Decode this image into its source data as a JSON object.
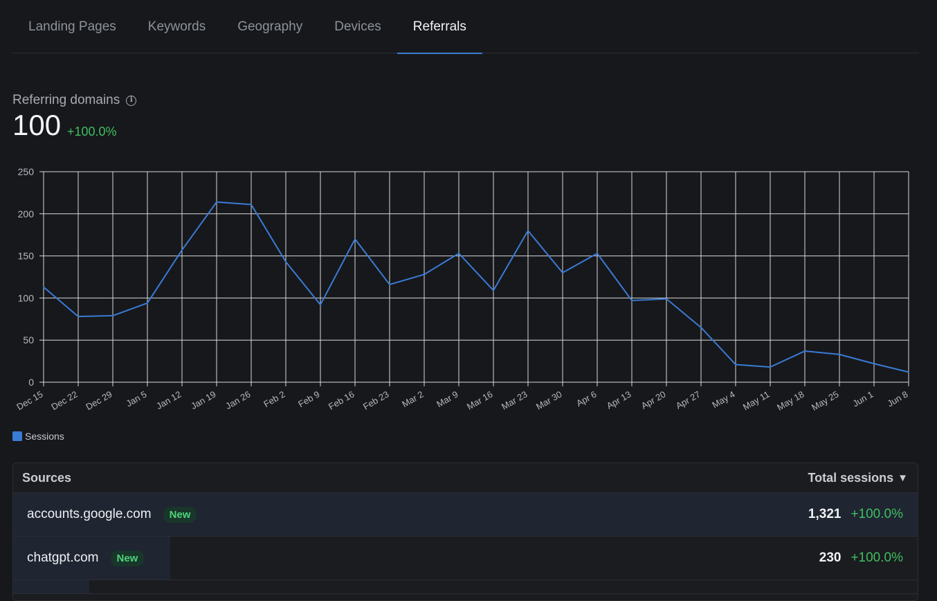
{
  "tabs": [
    {
      "label": "Landing Pages",
      "active": false
    },
    {
      "label": "Keywords",
      "active": false
    },
    {
      "label": "Geography",
      "active": false
    },
    {
      "label": "Devices",
      "active": false
    },
    {
      "label": "Referrals",
      "active": true
    }
  ],
  "metric": {
    "label": "Referring domains",
    "value": "100",
    "change": "+100.0%"
  },
  "chart_data": {
    "type": "line",
    "x": [
      "Dec 15",
      "Dec 22",
      "Dec 29",
      "Jan 5",
      "Jan 12",
      "Jan 19",
      "Jan 26",
      "Feb 2",
      "Feb 9",
      "Feb 16",
      "Feb 23",
      "Mar 2",
      "Mar 9",
      "Mar 16",
      "Mar 23",
      "Mar 30",
      "Apr 6",
      "Apr 13",
      "Apr 20",
      "Apr 27",
      "May 4",
      "May 11",
      "May 18",
      "May 25",
      "Jun 1",
      "Jun 8"
    ],
    "series": [
      {
        "name": "Sessions",
        "values": [
          113,
          78,
          79,
          94,
          157,
          214,
          211,
          143,
          92,
          170,
          116,
          128,
          153,
          109,
          180,
          130,
          153,
          97,
          99,
          65,
          21,
          18,
          37,
          33,
          22,
          12
        ],
        "color": "#3a7bd5"
      }
    ],
    "ylim": [
      0,
      250
    ],
    "yticks": [
      0,
      50,
      100,
      150,
      200,
      250
    ],
    "grid": true,
    "legend": "bottom-left"
  },
  "legend_label": "Sessions",
  "table": {
    "col_source": "Sources",
    "col_sessions": "Total sessions",
    "rows": [
      {
        "name": "accounts.google.com",
        "badge": "New",
        "count": "1,321",
        "pct": "+100.0%",
        "share": 1.0
      },
      {
        "name": "chatgpt.com",
        "badge": "New",
        "count": "230",
        "pct": "+100.0%",
        "share": 0.174
      }
    ]
  }
}
